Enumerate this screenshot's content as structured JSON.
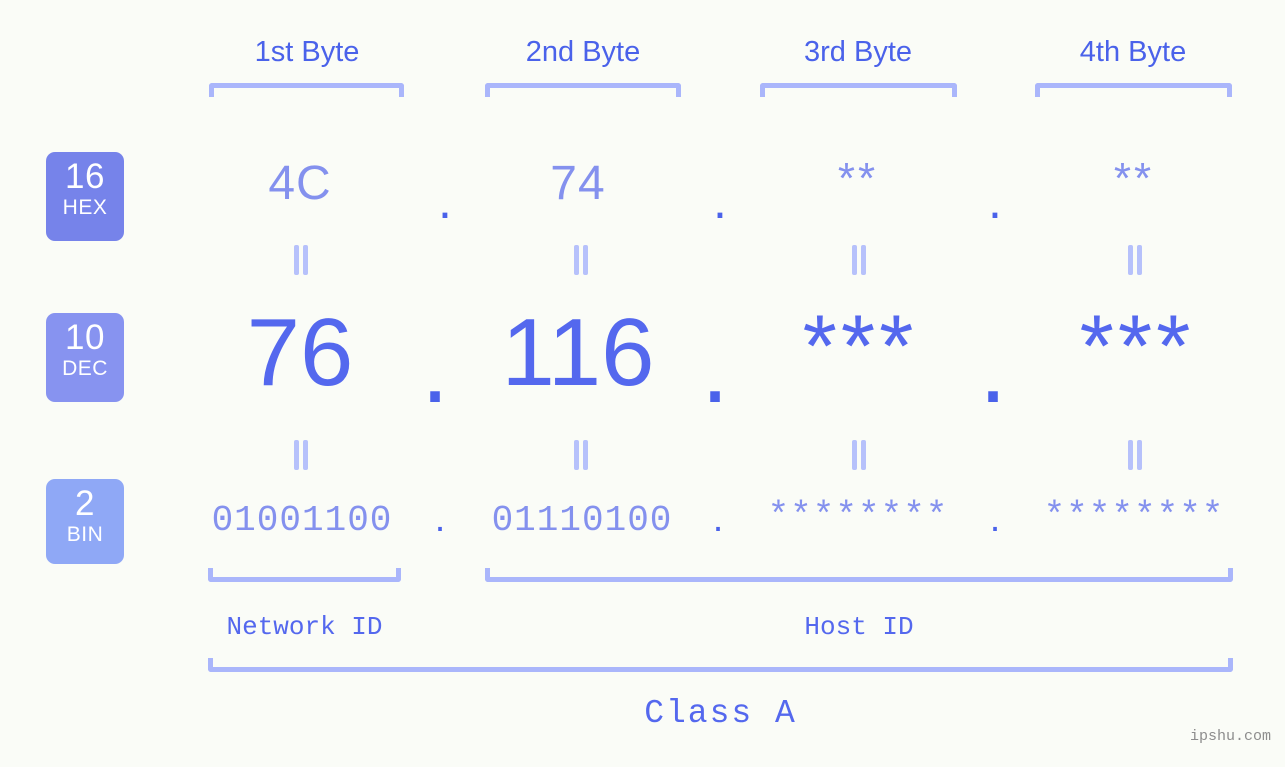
{
  "background": "#fafcf7",
  "accent": "#5468ee",
  "accent_light": "#8491ee",
  "bracket_color": "#aab6fb",
  "byte_headers": [
    {
      "label": "1st Byte"
    },
    {
      "label": "2nd Byte"
    },
    {
      "label": "3rd Byte"
    },
    {
      "label": "4th Byte"
    }
  ],
  "rows": [
    {
      "base": "16",
      "base_name": "HEX",
      "badge_color": "#7683ea",
      "values": [
        "4C",
        "74",
        "**",
        "**"
      ],
      "separator": "."
    },
    {
      "base": "10",
      "base_name": "DEC",
      "badge_color": "#8793f0",
      "values": [
        "76",
        "116",
        "***",
        "***"
      ],
      "separator": "."
    },
    {
      "base": "2",
      "base_name": "BIN",
      "badge_color": "#8fa8f6",
      "values": [
        "01001100",
        "01110100",
        "********",
        "********"
      ],
      "separator": "."
    }
  ],
  "equality_marks": [
    "||",
    "||",
    "||",
    "||",
    "||",
    "||",
    "||",
    "||"
  ],
  "groups": {
    "network_id": "Network ID",
    "host_id": "Host ID"
  },
  "class_label": "Class A",
  "watermark": "ipshu.com"
}
